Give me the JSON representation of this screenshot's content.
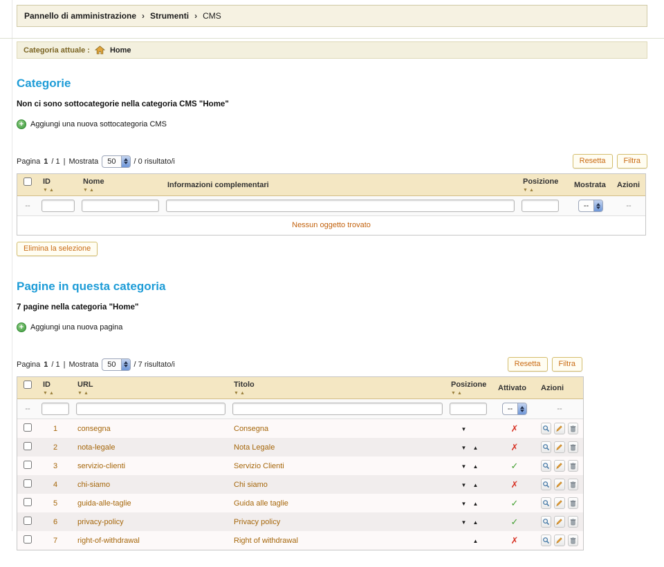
{
  "ui": {
    "glyphs": {
      "check": "✓",
      "cross": "✗",
      "up": "▲",
      "down": "▼",
      "sort_desc": "▼",
      "sort_asc": "▲",
      "plus": "+"
    },
    "colors": {
      "heading": "#1E9CD7",
      "table_link": "#A5660A",
      "active": "#3F9E2E",
      "inactive": "#D8372A",
      "header_bg": "#F4E7C3"
    }
  },
  "breadcrumb": {
    "items": [
      "Pannello di amministrazione",
      "Strumenti",
      "CMS"
    ],
    "separator": "›"
  },
  "current_category": {
    "label": "Categoria attuale :",
    "name": "Home"
  },
  "categories": {
    "title": "Categorie",
    "message": "Non ci sono sottocategorie nella categoria CMS \"Home\"",
    "add_label": "Aggiungi una nuova sottocategoria CMS",
    "pagination": {
      "label_page": "Pagina",
      "current": "1",
      "of": "/ 1",
      "separator": "|",
      "label_shown": "Mostrata",
      "per_page": "50",
      "results": "/ 0 risultato/i"
    },
    "reset_button": "Resetta",
    "filter_button": "Filtra",
    "headers": {
      "id": "ID",
      "name": "Nome",
      "info": "Informazioni complementari",
      "position": "Posizione",
      "displayed": "Mostrata",
      "actions": "Azioni"
    },
    "filter_dash": "--",
    "filter_select_value": "--",
    "empty_text": "Nessun oggetto trovato",
    "delete_button": "Elimina la selezione"
  },
  "pages": {
    "title": "Pagine in questa categoria",
    "message": "7 pagine nella categoria \"Home\"",
    "add_label": "Aggiungi una nuova pagina",
    "pagination": {
      "label_page": "Pagina",
      "current": "1",
      "of": "/ 1",
      "separator": "|",
      "label_shown": "Mostrata",
      "per_page": "50",
      "results": "/ 7 risultato/i"
    },
    "reset_button": "Resetta",
    "filter_button": "Filtra",
    "headers": {
      "id": "ID",
      "url": "URL",
      "title": "Titolo",
      "position": "Posizione",
      "active": "Attivato",
      "actions": "Azioni"
    },
    "filter_dash": "--",
    "filter_select_value": "--",
    "rows": [
      {
        "id": "1",
        "url": "consegna",
        "title": "Consegna",
        "position": "down",
        "active": false
      },
      {
        "id": "2",
        "url": "nota-legale",
        "title": "Nota Legale",
        "position": "both",
        "active": false
      },
      {
        "id": "3",
        "url": "servizio-clienti",
        "title": "Servizio Clienti",
        "position": "both",
        "active": true
      },
      {
        "id": "4",
        "url": "chi-siamo",
        "title": "Chi siamo",
        "position": "both",
        "active": false
      },
      {
        "id": "5",
        "url": "guida-alle-taglie",
        "title": "Guida alle taglie",
        "position": "both",
        "active": true
      },
      {
        "id": "6",
        "url": "privacy-policy",
        "title": "Privacy policy",
        "position": "both",
        "active": true
      },
      {
        "id": "7",
        "url": "right-of-withdrawal",
        "title": "Right of withdrawal",
        "position": "up",
        "active": false
      }
    ]
  }
}
